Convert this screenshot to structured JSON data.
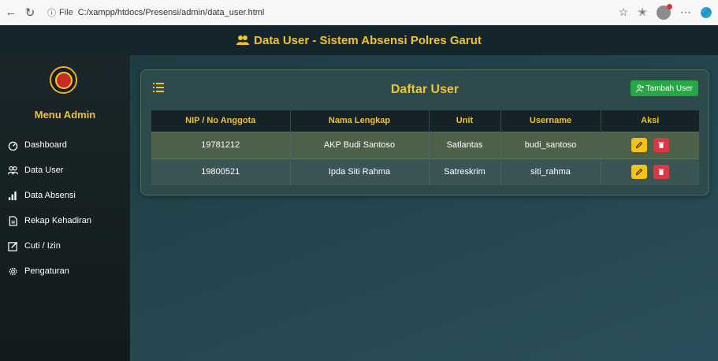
{
  "browser": {
    "url_scheme": "File",
    "url": "C:/xampp/htdocs/Presensi/admin/data_user.html"
  },
  "header": {
    "title": "Data User - Sistem Absensi Polres Garut"
  },
  "sidebar": {
    "title": "Menu Admin",
    "items": [
      {
        "label": "Dashboard",
        "icon": "dashboard-icon"
      },
      {
        "label": "Data User",
        "icon": "users-icon"
      },
      {
        "label": "Data Absensi",
        "icon": "chart-icon"
      },
      {
        "label": "Rekap Kehadiran",
        "icon": "document-icon"
      },
      {
        "label": "Cuti / Izin",
        "icon": "edit-icon"
      },
      {
        "label": "Pengaturan",
        "icon": "gear-icon"
      }
    ]
  },
  "card": {
    "title": "Daftar User",
    "add_button": "Tambah User"
  },
  "table": {
    "columns": [
      "NIP / No Anggota",
      "Nama Lengkap",
      "Unit",
      "Username",
      "Aksi"
    ],
    "rows": [
      [
        "19781212",
        "AKP Budi Santoso",
        "Satlantas",
        "budi_santoso"
      ],
      [
        "19800521",
        "Ipda Siti Rahma",
        "Satreskrim",
        "siti_rahma"
      ]
    ]
  },
  "colors": {
    "accent": "#f1c22a",
    "add": "#27a745",
    "edit": "#f7c312",
    "delete": "#dc3545"
  }
}
